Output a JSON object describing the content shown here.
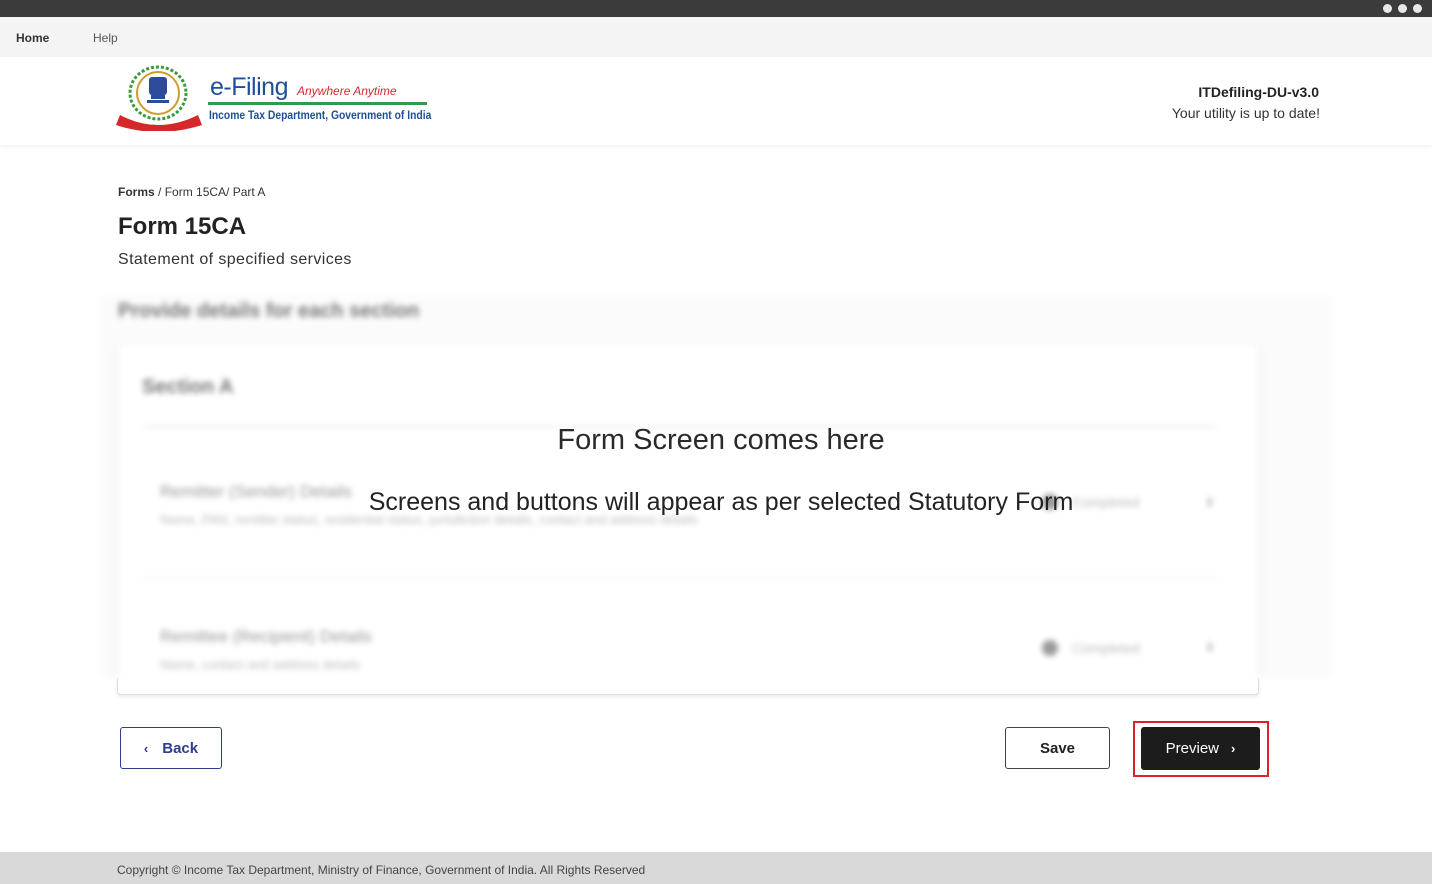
{
  "menu": {
    "home": "Home",
    "help": "Help"
  },
  "header": {
    "brand_title": "e-Filing",
    "brand_tagline": "Anywhere Anytime",
    "brand_subtitle": "Income Tax Department, Government of India",
    "utility_version": "ITDefiling-DU-v3.0",
    "utility_status": "Your utility is up to date!"
  },
  "breadcrumb": {
    "root": "Forms",
    "rest": " / Form 15CA/ Part A"
  },
  "page": {
    "title": "Form 15CA",
    "subtitle": "Statement of specified services"
  },
  "background_form": {
    "heading": "Provide details for each section",
    "section_title": "Section A",
    "rows": [
      {
        "title": "Remitter (Sender) Details",
        "subtitle": "Name, PAN, remitter status, residential status, jurisdiction details, contact and address details",
        "status": "Completed"
      },
      {
        "title": "Remittee (Recipient) Details",
        "subtitle": "Name, contact and address details",
        "status": "Completed"
      }
    ]
  },
  "overlay": {
    "title": "Form Screen comes here",
    "subtitle": "Screens and buttons will appear as per selected Statutory Form"
  },
  "actions": {
    "back": "Back",
    "save": "Save",
    "preview": "Preview"
  },
  "footer": {
    "copyright": "Copyright © Income Tax Department, Ministry of Finance, Government of India. All Rights Reserved"
  },
  "colors": {
    "accent": "#2c3e8c",
    "highlight": "#d8232a",
    "primary_button": "#1c1c1c"
  }
}
